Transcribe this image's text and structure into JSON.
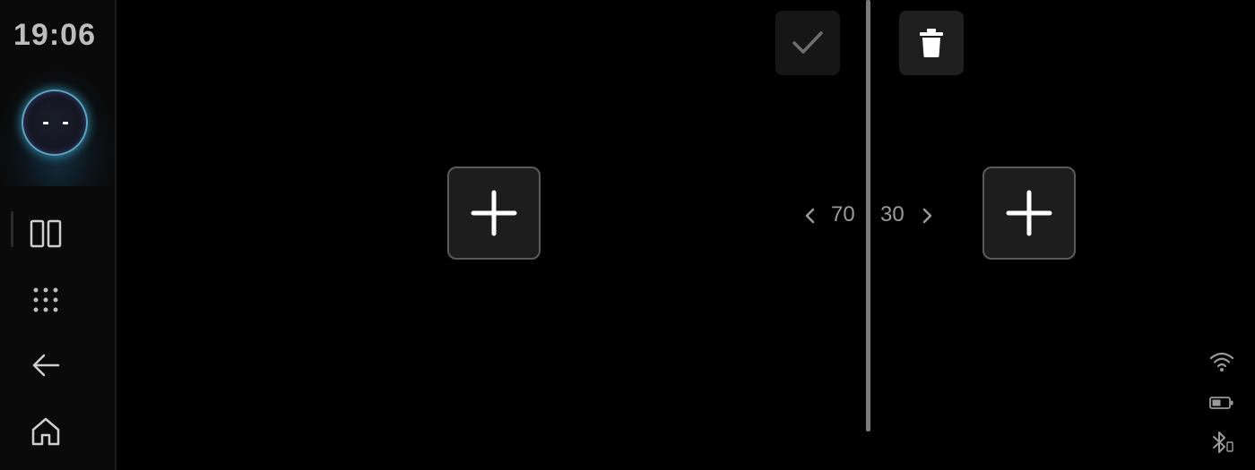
{
  "status_bar": {
    "time": "19:06"
  },
  "sidebar": {
    "items": [
      {
        "name": "split-screen",
        "icon": "split-screen-icon"
      },
      {
        "name": "apps",
        "icon": "app-grid-icon"
      },
      {
        "name": "back",
        "icon": "back-arrow-icon"
      },
      {
        "name": "home",
        "icon": "home-icon"
      }
    ]
  },
  "split_view": {
    "left_ratio": "70",
    "right_ratio": "30",
    "confirm_icon": "checkmark-icon",
    "delete_icon": "trash-icon",
    "add_icon": "plus-icon"
  },
  "system_tray": {
    "icons": [
      "wifi-icon",
      "battery-icon",
      "bluetooth-icon"
    ]
  },
  "colors": {
    "background": "#000000",
    "sidebar": "#0a0a0a",
    "button": "#1d1d1d",
    "divider": "#7a7a7a",
    "text_muted": "#9a9a9a",
    "assistant_glow": "#46bee6"
  }
}
